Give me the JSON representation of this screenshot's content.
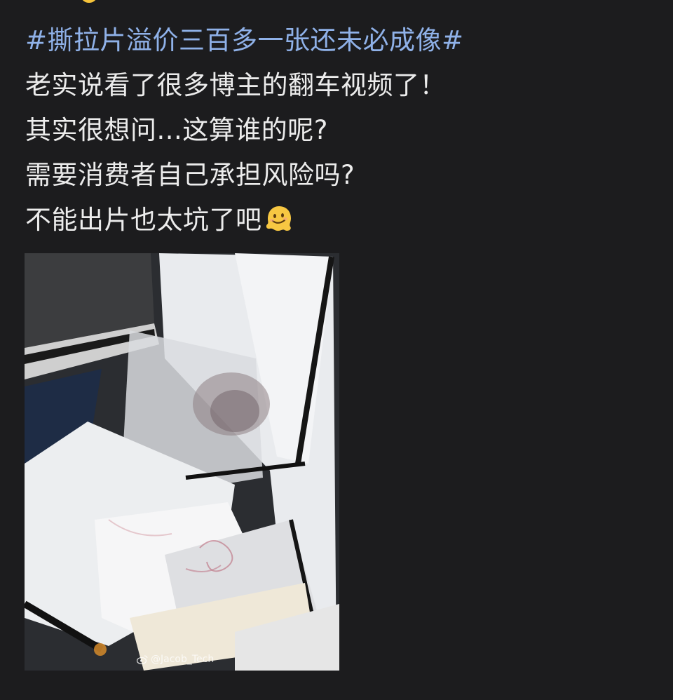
{
  "post": {
    "hashtag": "#撕拉片溢价三百多一张还未必成像#",
    "lines": [
      "老实说看了很多博主的翻车视频了！",
      "其实很想问...这算谁的呢?",
      "需要消费者自己承担风险吗?",
      "不能出片也太坑了吧"
    ],
    "trailing_emoji": "melting-face-icon"
  },
  "media": {
    "watermark": "@Jacob_Tech"
  },
  "colors": {
    "background": "#1c1c1e",
    "hashtag": "#8fb1e8",
    "text": "#ececec"
  }
}
